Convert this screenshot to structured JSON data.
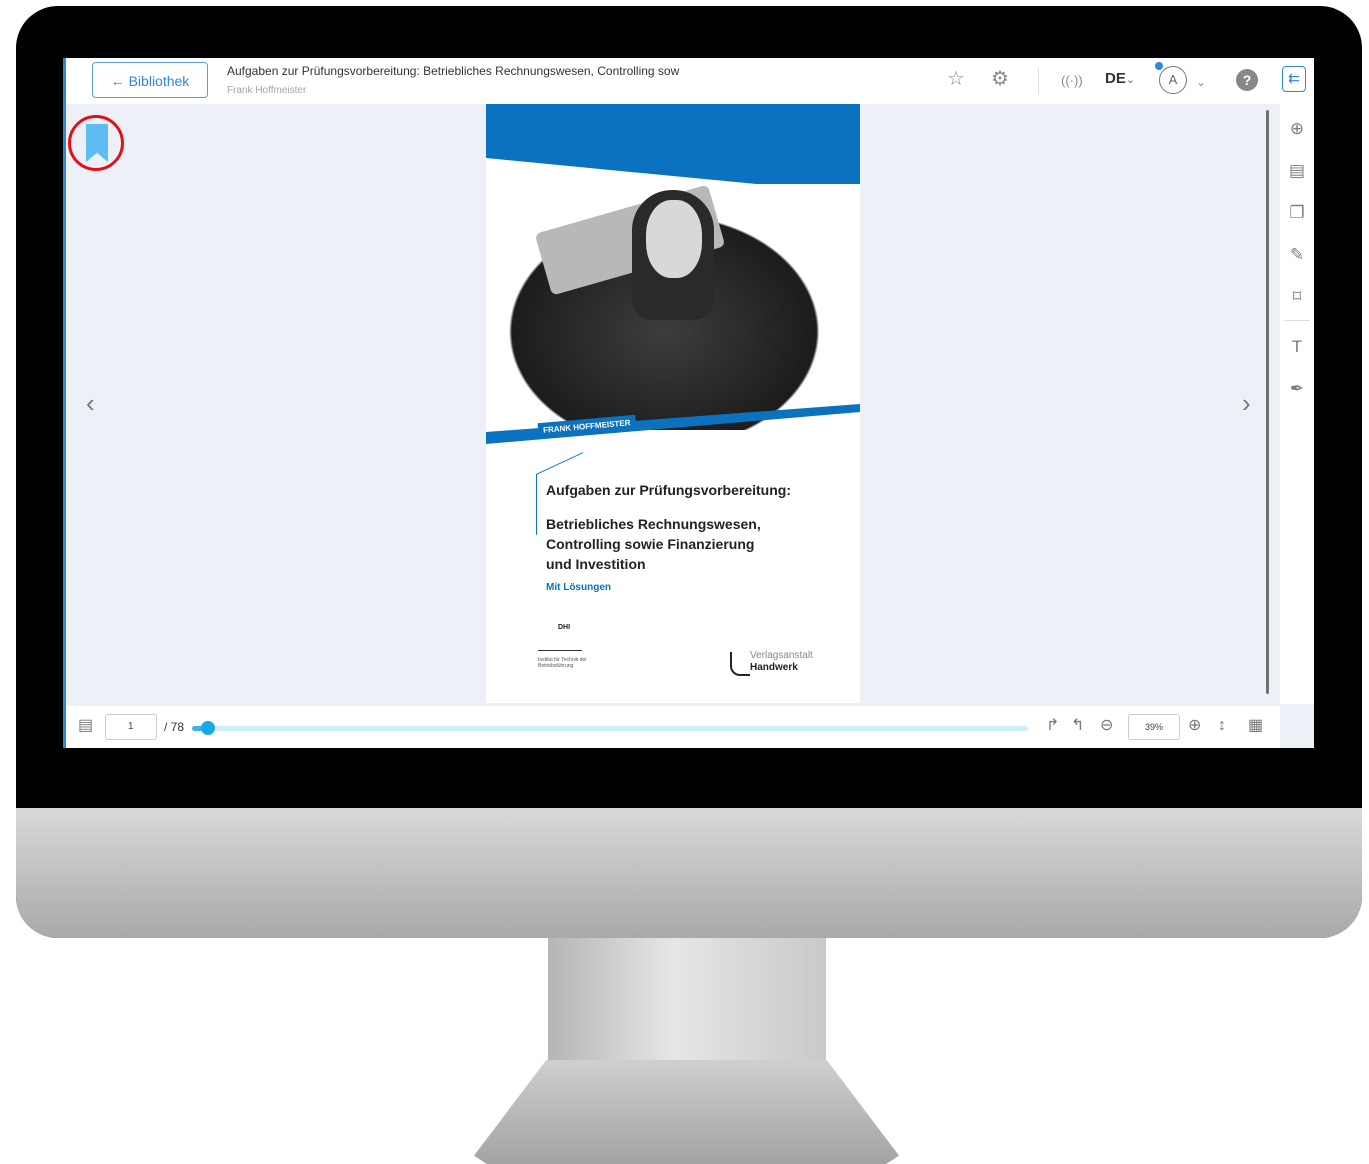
{
  "header": {
    "back_label": "← Bibliothek",
    "title": "Aufgaben zur Prüfungsvorbereitung: Betriebliches Rechnungswesen, Controlling sow",
    "author": "Frank Hoffmeister",
    "language": "DE",
    "language_chevron": "⌄",
    "user_initial": "Ⓐ",
    "user_chevron": "⌄",
    "help_label": "?",
    "icons": [
      "star-icon",
      "gear-icon",
      "broadcast-icon",
      "user-icon",
      "help-icon",
      "panel-toggle-icon"
    ]
  },
  "page": {
    "author_tag": "FRANK HOFFMEISTER",
    "title": "Aufgaben zur Prüfungsvorbereitung:",
    "subtitle_line1": "Betriebliches Rechnungswesen,",
    "subtitle_line2": "Controlling sowie Finanzierung",
    "subtitle_line3": "und Investition",
    "note": "Mit Lösungen",
    "dhi_logo": "DHI",
    "dhi_caption": "Institut für Technik der Betriebsführung",
    "publisher_line1": "Verlagsanstalt",
    "publisher_line2": "Handwerk"
  },
  "footer": {
    "current_page": "1",
    "total_pages": "/ 78",
    "progress_fraction": 0.013,
    "zoom": "39%"
  },
  "sidebar": {
    "icons": [
      "search-icon",
      "table-of-contents-icon",
      "pages-icon",
      "notes-icon",
      "bookmark-icon",
      "text-select-icon",
      "pen-icon"
    ]
  },
  "colors": {
    "accent": "#2e86de",
    "cover_blue": "#0a72be",
    "bookmark": "#5dbdf2",
    "highlight_ring": "#e0101a"
  }
}
